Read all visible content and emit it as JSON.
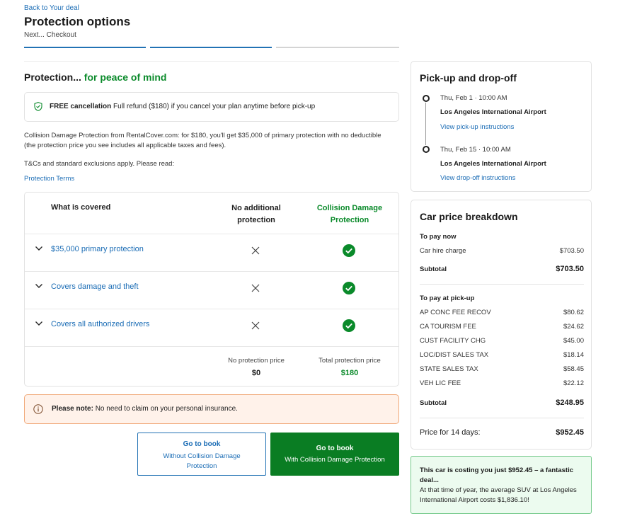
{
  "header": {
    "back_link": "Back to Your deal",
    "title": "Protection options",
    "subtitle": "Next... Checkout"
  },
  "progress": {
    "steps_total": 3,
    "steps_completed": 2
  },
  "protection": {
    "title_main": "Protection...",
    "title_accent": " for peace of mind",
    "free_cancel_bold": "FREE cancellation",
    "free_cancel_text": " Full refund ($180) if you cancel your plan anytime before pick-up",
    "description": "Collision Damage Protection from RentalCover.com: for $180, you'll get $35,000 of primary protection with no deductible (the protection price you see includes all applicable taxes and fees).",
    "tcs": "T&Cs and standard exclusions apply. Please read:",
    "terms_link": "Protection Terms"
  },
  "coverage": {
    "col_what": "What is covered",
    "col_none": "No additional protection",
    "col_cdp": "Collision Damage Protection",
    "rows": [
      {
        "label": "$35,000 primary protection"
      },
      {
        "label": "Covers damage and theft"
      },
      {
        "label": "Covers all authorized drivers"
      }
    ],
    "none_price_label": "No protection price",
    "none_price_value": "$0",
    "cdp_price_label": "Total protection price",
    "cdp_price_value": "$180"
  },
  "note": {
    "bold": "Please note:",
    "text": " No need to claim on your personal insurance."
  },
  "buttons": {
    "without_title": "Go to book",
    "without_sub": "Without Collision Damage Protection",
    "with_title": "Go to book",
    "with_sub": "With Collision Damage Protection"
  },
  "pickup": {
    "title": "Pick-up and drop-off",
    "pickup_date": "Thu, Feb 1 · 10:00 AM",
    "pickup_location": "Los Angeles International Airport",
    "pickup_link": "View pick-up instructions",
    "dropoff_date": "Thu, Feb 15 · 10:00 AM",
    "dropoff_location": "Los Angeles International Airport",
    "dropoff_link": "View drop-off instructions"
  },
  "price": {
    "title": "Car price breakdown",
    "pay_now_label": "To pay now",
    "pay_now_items": [
      {
        "label": "Car hire charge",
        "value": "$703.50"
      }
    ],
    "subtotal_now_label": "Subtotal",
    "subtotal_now_value": "$703.50",
    "pay_pickup_label": "To pay at pick-up",
    "pay_pickup_items": [
      {
        "label": "AP CONC FEE RECOV",
        "value": "$80.62"
      },
      {
        "label": "CA TOURISM FEE",
        "value": "$24.62"
      },
      {
        "label": "CUST FACILITY CHG",
        "value": "$45.00"
      },
      {
        "label": "LOC/DIST SALES TAX",
        "value": "$18.14"
      },
      {
        "label": "STATE SALES TAX",
        "value": "$58.45"
      },
      {
        "label": "VEH LIC FEE",
        "value": "$22.12"
      }
    ],
    "subtotal_pickup_label": "Subtotal",
    "subtotal_pickup_value": "$248.95",
    "total_label": "Price for 14 days:",
    "total_value": "$952.45"
  },
  "deal": {
    "headline": "This car is costing you just $952.45 – a fantastic deal...",
    "body": "At that time of year, the average SUV at Los Angeles International Airport costs $1,836.10!"
  },
  "colors": {
    "brand_blue": "#1a6cb5",
    "accent_green": "#0a8a2a",
    "button_green": "#0a7d23",
    "note_bg": "#fff2ea",
    "note_border": "#f0a878"
  },
  "icons": [
    "shield-check-icon",
    "chevron-down-icon",
    "x-mark-icon",
    "check-circle-icon",
    "info-icon"
  ]
}
